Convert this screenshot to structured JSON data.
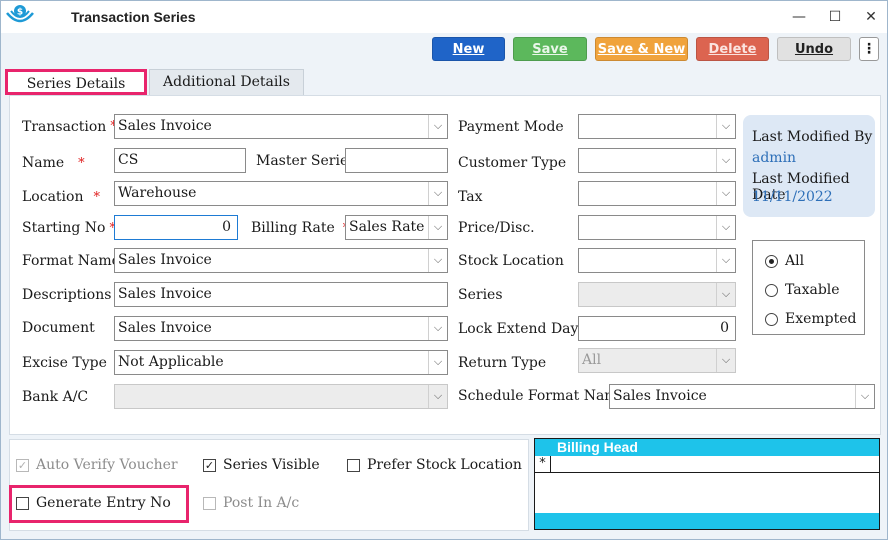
{
  "window": {
    "title": "Transaction Series",
    "controls": {
      "minimize": "—",
      "maximize": "☐",
      "close": "✕"
    }
  },
  "toolbar": {
    "new_label": "New",
    "save_label": "Save",
    "save_new_label": "Save & New",
    "delete_label": "Delete",
    "undo_label": "Undo",
    "more_label": "⋮"
  },
  "tabs": [
    {
      "label": "Series Details"
    },
    {
      "label": "Additional Details"
    }
  ],
  "form": {
    "transaction": {
      "label": "Transaction",
      "required": "*",
      "value": "Sales Invoice"
    },
    "name": {
      "label": "Name",
      "required": "*",
      "value": "CS"
    },
    "master_series": {
      "label": "Master Series",
      "value": ""
    },
    "location": {
      "label": "Location",
      "required": "*",
      "value": "Warehouse"
    },
    "starting_no": {
      "label": "Starting No",
      "required": "*",
      "value": "0"
    },
    "billing_rate": {
      "label": "Billing Rate",
      "required": "*",
      "value": "Sales Rate"
    },
    "format_name": {
      "label": "Format Name",
      "value": "Sales Invoice"
    },
    "descriptions": {
      "label": "Descriptions",
      "value": "Sales Invoice"
    },
    "document": {
      "label": "Document",
      "value": "Sales Invoice"
    },
    "excise_type": {
      "label": "Excise Type",
      "value": "Not Applicable"
    },
    "bank_ac": {
      "label": "Bank A/C",
      "value": ""
    },
    "payment_mode": {
      "label": "Payment Mode",
      "value": ""
    },
    "customer_type": {
      "label": "Customer Type",
      "value": ""
    },
    "tax": {
      "label": "Tax",
      "value": ""
    },
    "price_disc": {
      "label": "Price/Disc.",
      "value": ""
    },
    "stock_location": {
      "label": "Stock Location",
      "value": ""
    },
    "series": {
      "label": "Series",
      "value": ""
    },
    "lock_extend_days": {
      "label": "Lock Extend Days",
      "value": "0"
    },
    "return_type": {
      "label": "Return Type",
      "value": "All"
    },
    "schedule_format_name": {
      "label": "Schedule Format Name",
      "value": "Sales Invoice"
    }
  },
  "modified": {
    "by_label": "Last Modified By",
    "by_value": "admin",
    "date_label": "Last Modified Date",
    "date_value": "11/11/2022"
  },
  "tax_filter": {
    "options": [
      "All",
      "Taxable",
      "Exempted"
    ],
    "selected": "All"
  },
  "options": {
    "auto_verify_voucher": {
      "label": "Auto Verify Voucher",
      "checked": true,
      "enabled": false
    },
    "series_visible": {
      "label": "Series Visible",
      "checked": true,
      "enabled": true
    },
    "prefer_stock_location": {
      "label": "Prefer Stock Location",
      "checked": false,
      "enabled": true
    },
    "generate_entry_no": {
      "label": "Generate Entry No",
      "checked": false,
      "enabled": true
    },
    "post_in_ac": {
      "label": "Post In A/c",
      "checked": false,
      "enabled": false
    }
  },
  "billing_grid": {
    "header": "Billing Head",
    "new_row_marker": "*"
  },
  "colors": {
    "accent_highlight": "#e8246c",
    "new_button": "#1f64c8",
    "save_button": "#5cb85c",
    "save_new_button": "#f0a33c",
    "delete_button": "#dc6450",
    "grid_header": "#1ec3ea"
  },
  "icons": {
    "app_logo": "app-logo-icon",
    "dropdown": "chevron-down-icon",
    "more": "kebab-menu-icon"
  }
}
